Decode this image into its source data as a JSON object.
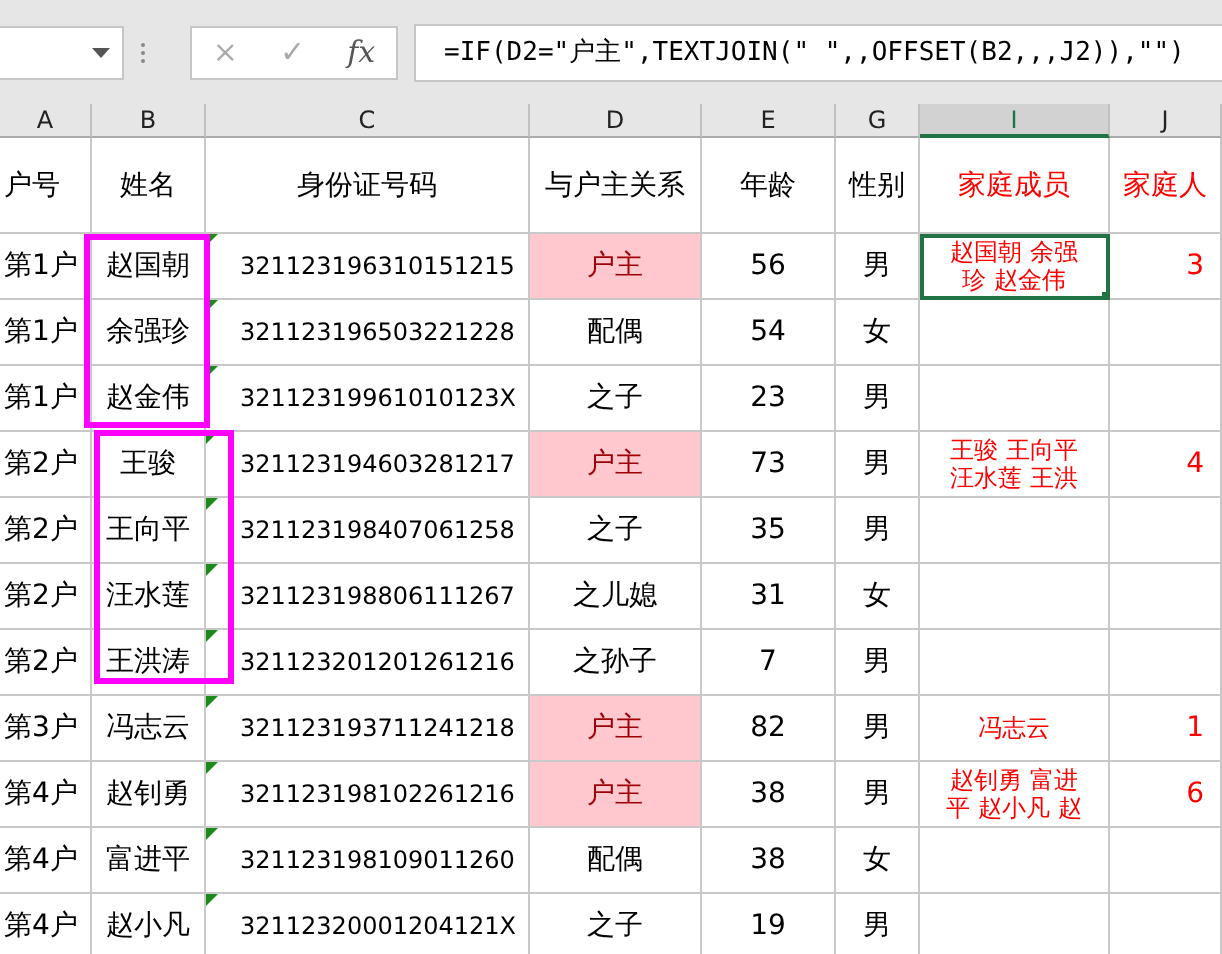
{
  "formula_bar": {
    "cancel": "×",
    "enter": "✓",
    "function": "fx",
    "formula": "=IF(D2=\"户主\",TEXTJOIN(\" \",,OFFSET(B2,,,J2)),\"\")"
  },
  "columns": [
    {
      "label": "A",
      "selected": false
    },
    {
      "label": "B",
      "selected": false
    },
    {
      "label": "C",
      "selected": false
    },
    {
      "label": "D",
      "selected": false
    },
    {
      "label": "E",
      "selected": false
    },
    {
      "label": "G",
      "selected": false
    },
    {
      "label": "I",
      "selected": true
    },
    {
      "label": "J",
      "selected": false
    }
  ],
  "headers": [
    {
      "label": "户号",
      "color": "#000000"
    },
    {
      "label": "姓名",
      "color": "#000000"
    },
    {
      "label": "身份证号码",
      "color": "#000000"
    },
    {
      "label": "与户主关系",
      "color": "#000000"
    },
    {
      "label": "年龄",
      "color": "#000000"
    },
    {
      "label": "性别",
      "color": "#000000"
    },
    {
      "label": "家庭成员",
      "color": "#ff0000"
    },
    {
      "label": "家庭人",
      "color": "#ff0000"
    }
  ],
  "rows": [
    {
      "household": "第1户",
      "name": "赵国朝",
      "id": "321123196310151215",
      "relation": "户主",
      "head": true,
      "age": "56",
      "gender": "男",
      "members": "赵国朝 余强珍 赵金伟",
      "count": "3",
      "selected": true
    },
    {
      "household": "第1户",
      "name": "余强珍",
      "id": "321123196503221228",
      "relation": "配偶",
      "head": false,
      "age": "54",
      "gender": "女",
      "members": "",
      "count": "",
      "selected": false
    },
    {
      "household": "第1户",
      "name": "赵金伟",
      "id": "32112319961010123X",
      "relation": "之子",
      "head": false,
      "age": "23",
      "gender": "男",
      "members": "",
      "count": "",
      "selected": false
    },
    {
      "household": "第2户",
      "name": "王骏",
      "id": "321123194603281217",
      "relation": "户主",
      "head": true,
      "age": "73",
      "gender": "男",
      "members": "王骏 王向平汪水莲 王洪",
      "count": "4",
      "selected": false
    },
    {
      "household": "第2户",
      "name": "王向平",
      "id": "321123198407061258",
      "relation": "之子",
      "head": false,
      "age": "35",
      "gender": "男",
      "members": "",
      "count": "",
      "selected": false
    },
    {
      "household": "第2户",
      "name": "汪水莲",
      "id": "321123198806111267",
      "relation": "之儿媳",
      "head": false,
      "age": "31",
      "gender": "女",
      "members": "",
      "count": "",
      "selected": false
    },
    {
      "household": "第2户",
      "name": "王洪涛",
      "id": "321123201201261216",
      "relation": "之孙子",
      "head": false,
      "age": "7",
      "gender": "男",
      "members": "",
      "count": "",
      "selected": false
    },
    {
      "household": "第3户",
      "name": "冯志云",
      "id": "321123193711241218",
      "relation": "户主",
      "head": true,
      "age": "82",
      "gender": "男",
      "members": "冯志云",
      "count": "1",
      "selected": false
    },
    {
      "household": "第4户",
      "name": "赵钊勇",
      "id": "321123198102261216",
      "relation": "户主",
      "head": true,
      "age": "38",
      "gender": "男",
      "members": "赵钊勇 富进平 赵小凡 赵",
      "count": "6",
      "selected": false
    },
    {
      "household": "第4户",
      "name": "富进平",
      "id": "321123198109011260",
      "relation": "配偶",
      "head": false,
      "age": "38",
      "gender": "女",
      "members": "",
      "count": "",
      "selected": false
    },
    {
      "household": "第4户",
      "name": "赵小凡",
      "id": "32112320001204121X",
      "relation": "之子",
      "head": false,
      "age": "19",
      "gender": "男",
      "members": "",
      "count": "",
      "selected": false
    }
  ]
}
